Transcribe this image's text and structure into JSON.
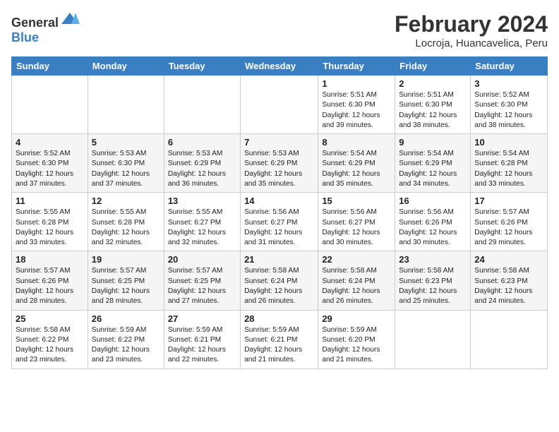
{
  "header": {
    "logo_general": "General",
    "logo_blue": "Blue",
    "month": "February 2024",
    "location": "Locroja, Huancavelica, Peru"
  },
  "days_of_week": [
    "Sunday",
    "Monday",
    "Tuesday",
    "Wednesday",
    "Thursday",
    "Friday",
    "Saturday"
  ],
  "weeks": [
    [
      {
        "day": "",
        "info": ""
      },
      {
        "day": "",
        "info": ""
      },
      {
        "day": "",
        "info": ""
      },
      {
        "day": "",
        "info": ""
      },
      {
        "day": "1",
        "info": "Sunrise: 5:51 AM\nSunset: 6:30 PM\nDaylight: 12 hours\nand 39 minutes."
      },
      {
        "day": "2",
        "info": "Sunrise: 5:51 AM\nSunset: 6:30 PM\nDaylight: 12 hours\nand 38 minutes."
      },
      {
        "day": "3",
        "info": "Sunrise: 5:52 AM\nSunset: 6:30 PM\nDaylight: 12 hours\nand 38 minutes."
      }
    ],
    [
      {
        "day": "4",
        "info": "Sunrise: 5:52 AM\nSunset: 6:30 PM\nDaylight: 12 hours\nand 37 minutes."
      },
      {
        "day": "5",
        "info": "Sunrise: 5:53 AM\nSunset: 6:30 PM\nDaylight: 12 hours\nand 37 minutes."
      },
      {
        "day": "6",
        "info": "Sunrise: 5:53 AM\nSunset: 6:29 PM\nDaylight: 12 hours\nand 36 minutes."
      },
      {
        "day": "7",
        "info": "Sunrise: 5:53 AM\nSunset: 6:29 PM\nDaylight: 12 hours\nand 35 minutes."
      },
      {
        "day": "8",
        "info": "Sunrise: 5:54 AM\nSunset: 6:29 PM\nDaylight: 12 hours\nand 35 minutes."
      },
      {
        "day": "9",
        "info": "Sunrise: 5:54 AM\nSunset: 6:29 PM\nDaylight: 12 hours\nand 34 minutes."
      },
      {
        "day": "10",
        "info": "Sunrise: 5:54 AM\nSunset: 6:28 PM\nDaylight: 12 hours\nand 33 minutes."
      }
    ],
    [
      {
        "day": "11",
        "info": "Sunrise: 5:55 AM\nSunset: 6:28 PM\nDaylight: 12 hours\nand 33 minutes."
      },
      {
        "day": "12",
        "info": "Sunrise: 5:55 AM\nSunset: 6:28 PM\nDaylight: 12 hours\nand 32 minutes."
      },
      {
        "day": "13",
        "info": "Sunrise: 5:55 AM\nSunset: 6:27 PM\nDaylight: 12 hours\nand 32 minutes."
      },
      {
        "day": "14",
        "info": "Sunrise: 5:56 AM\nSunset: 6:27 PM\nDaylight: 12 hours\nand 31 minutes."
      },
      {
        "day": "15",
        "info": "Sunrise: 5:56 AM\nSunset: 6:27 PM\nDaylight: 12 hours\nand 30 minutes."
      },
      {
        "day": "16",
        "info": "Sunrise: 5:56 AM\nSunset: 6:26 PM\nDaylight: 12 hours\nand 30 minutes."
      },
      {
        "day": "17",
        "info": "Sunrise: 5:57 AM\nSunset: 6:26 PM\nDaylight: 12 hours\nand 29 minutes."
      }
    ],
    [
      {
        "day": "18",
        "info": "Sunrise: 5:57 AM\nSunset: 6:26 PM\nDaylight: 12 hours\nand 28 minutes."
      },
      {
        "day": "19",
        "info": "Sunrise: 5:57 AM\nSunset: 6:25 PM\nDaylight: 12 hours\nand 28 minutes."
      },
      {
        "day": "20",
        "info": "Sunrise: 5:57 AM\nSunset: 6:25 PM\nDaylight: 12 hours\nand 27 minutes."
      },
      {
        "day": "21",
        "info": "Sunrise: 5:58 AM\nSunset: 6:24 PM\nDaylight: 12 hours\nand 26 minutes."
      },
      {
        "day": "22",
        "info": "Sunrise: 5:58 AM\nSunset: 6:24 PM\nDaylight: 12 hours\nand 26 minutes."
      },
      {
        "day": "23",
        "info": "Sunrise: 5:58 AM\nSunset: 6:23 PM\nDaylight: 12 hours\nand 25 minutes."
      },
      {
        "day": "24",
        "info": "Sunrise: 5:58 AM\nSunset: 6:23 PM\nDaylight: 12 hours\nand 24 minutes."
      }
    ],
    [
      {
        "day": "25",
        "info": "Sunrise: 5:58 AM\nSunset: 6:22 PM\nDaylight: 12 hours\nand 23 minutes."
      },
      {
        "day": "26",
        "info": "Sunrise: 5:59 AM\nSunset: 6:22 PM\nDaylight: 12 hours\nand 23 minutes."
      },
      {
        "day": "27",
        "info": "Sunrise: 5:59 AM\nSunset: 6:21 PM\nDaylight: 12 hours\nand 22 minutes."
      },
      {
        "day": "28",
        "info": "Sunrise: 5:59 AM\nSunset: 6:21 PM\nDaylight: 12 hours\nand 21 minutes."
      },
      {
        "day": "29",
        "info": "Sunrise: 5:59 AM\nSunset: 6:20 PM\nDaylight: 12 hours\nand 21 minutes."
      },
      {
        "day": "",
        "info": ""
      },
      {
        "day": "",
        "info": ""
      }
    ]
  ]
}
